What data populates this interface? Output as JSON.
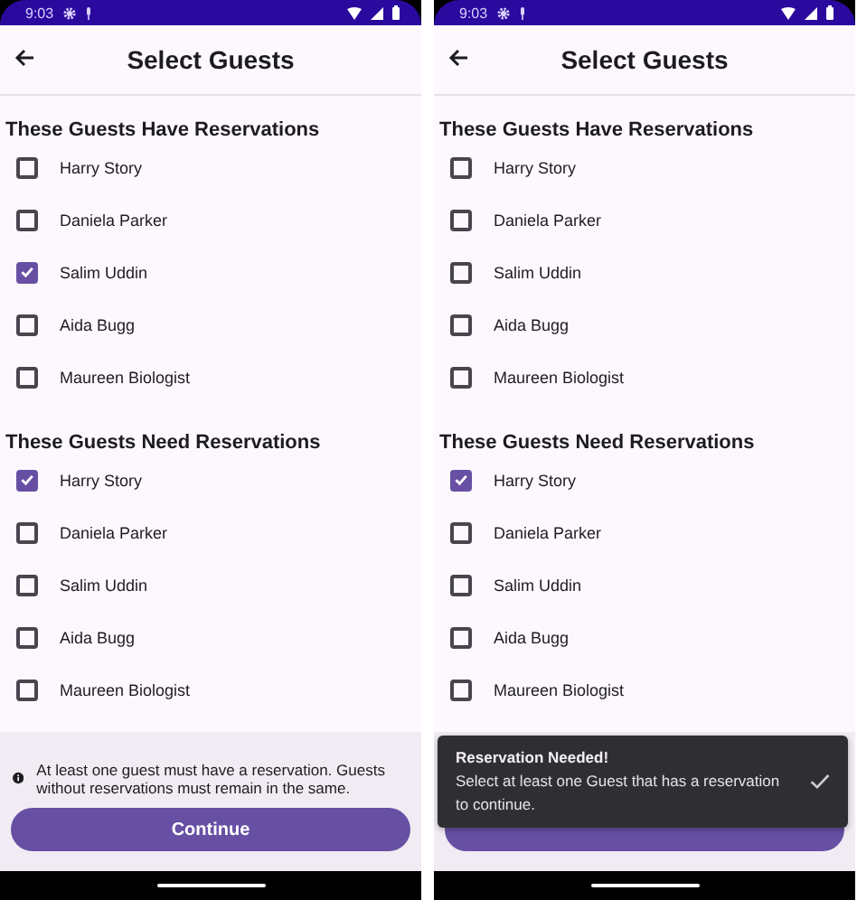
{
  "phones": [
    {
      "status_bar": {
        "time": "9:03"
      },
      "app_bar": {
        "title": "Select Guests"
      },
      "sections": [
        {
          "title": "These Guests Have Reservations",
          "guests": [
            {
              "name": "Harry Story",
              "checked": false
            },
            {
              "name": "Daniela Parker",
              "checked": false
            },
            {
              "name": "Salim Uddin",
              "checked": true
            },
            {
              "name": "Aida Bugg",
              "checked": false
            },
            {
              "name": "Maureen Biologist",
              "checked": false
            }
          ]
        },
        {
          "title": "These Guests Need Reservations",
          "guests": [
            {
              "name": "Harry Story",
              "checked": true
            },
            {
              "name": "Daniela Parker",
              "checked": false
            },
            {
              "name": "Salim Uddin",
              "checked": false
            },
            {
              "name": "Aida Bugg",
              "checked": false
            },
            {
              "name": "Maureen Biologist",
              "checked": false
            }
          ]
        }
      ],
      "notice": {
        "text": "At least one guest must have a reservation. Guests without reservations must remain in the same."
      },
      "button": {
        "label": "Continue"
      }
    },
    {
      "status_bar": {
        "time": "9:03"
      },
      "app_bar": {
        "title": "Select Guests"
      },
      "sections": [
        {
          "title": "These Guests Have Reservations",
          "guests": [
            {
              "name": "Harry Story",
              "checked": false
            },
            {
              "name": "Daniela Parker",
              "checked": false
            },
            {
              "name": "Salim Uddin",
              "checked": false
            },
            {
              "name": "Aida Bugg",
              "checked": false
            },
            {
              "name": "Maureen Biologist",
              "checked": false
            }
          ]
        },
        {
          "title": "These Guests Need Reservations",
          "guests": [
            {
              "name": "Harry Story",
              "checked": true
            },
            {
              "name": "Daniela Parker",
              "checked": false
            },
            {
              "name": "Salim Uddin",
              "checked": false
            },
            {
              "name": "Aida Bugg",
              "checked": false
            },
            {
              "name": "Maureen Biologist",
              "checked": false
            }
          ]
        }
      ],
      "button": {
        "covered": true
      },
      "snackbar": {
        "title": "Reservation Needed!",
        "message": "Select at least one Guest that has a reservation to continue."
      }
    }
  ]
}
